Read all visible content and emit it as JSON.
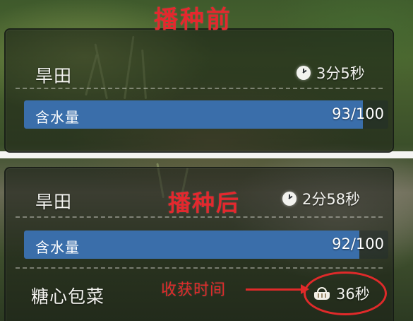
{
  "annotations": {
    "before_title": "播种前",
    "after_title": "播种后",
    "harvest_note": "收获时间",
    "accent_color": "#e02a2a"
  },
  "before": {
    "field_name": "旱田",
    "time_icon": "clock-icon",
    "time_remaining": "3分5秒",
    "water": {
      "label": "含水量",
      "value_text": "93/100",
      "current": 93,
      "max": 100,
      "fill_color": "#3a6eaa"
    }
  },
  "after": {
    "field_name": "旱田",
    "time_icon": "clock-icon",
    "time_remaining": "2分58秒",
    "water": {
      "label": "含水量",
      "value_text": "92/100",
      "current": 92,
      "max": 100,
      "fill_color": "#3a6eaa"
    },
    "crop": {
      "name": "糖心包菜",
      "harvest_icon": "basket-icon",
      "harvest_time": "36秒"
    }
  }
}
